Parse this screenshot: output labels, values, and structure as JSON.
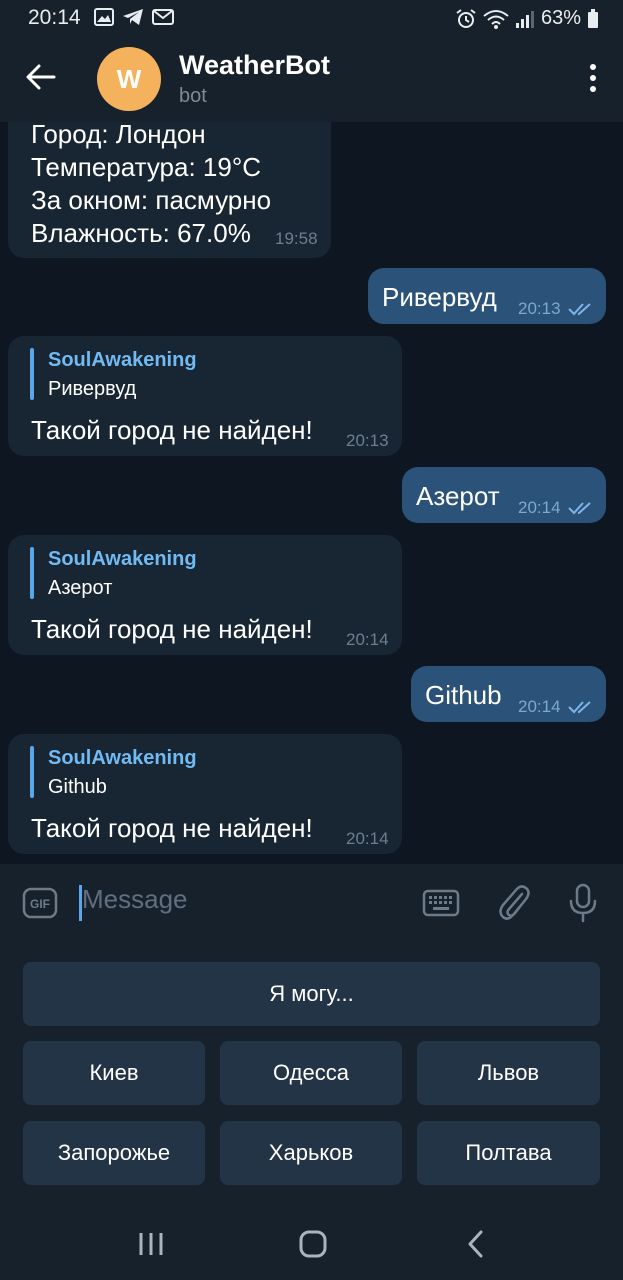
{
  "status_bar": {
    "time": "20:14",
    "battery": "63%",
    "left_icons": [
      "image-icon",
      "telegram-icon",
      "gmail-icon"
    ],
    "right_icons": [
      "alarm-icon",
      "wifi-icon",
      "signal-icon",
      "battery-icon"
    ]
  },
  "header": {
    "avatar_letter": "W",
    "avatar_color": "#f4b25c",
    "title": "WeatherBot",
    "subtitle": "bot"
  },
  "messages": [
    {
      "direction": "in",
      "lines": [
        "Город: Лондон",
        "Температура: 19°C",
        "За окном: пасмурно",
        "Влажность: 67.0%"
      ],
      "time": "19:58"
    },
    {
      "direction": "out",
      "text": "Ривервуд",
      "time": "20:13",
      "read": true
    },
    {
      "direction": "in",
      "reply_name": "SoulAwakening",
      "reply_text": "Ривервуд",
      "text": "Такой город не найден!",
      "time": "20:13"
    },
    {
      "direction": "out",
      "text": "Азерот",
      "time": "20:14",
      "read": true
    },
    {
      "direction": "in",
      "reply_name": "SoulAwakening",
      "reply_text": "Азерот",
      "text": "Такой город не найден!",
      "time": "20:14"
    },
    {
      "direction": "out",
      "text": "Github",
      "time": "20:14",
      "read": true
    },
    {
      "direction": "in",
      "reply_name": "SoulAwakening",
      "reply_text": "Github",
      "text": "Такой город не найден!",
      "time": "20:14"
    }
  ],
  "input": {
    "placeholder": "Message",
    "value": ""
  },
  "keyboard": {
    "rows": [
      [
        "Я могу..."
      ],
      [
        "Киев",
        "Одесса",
        "Львов"
      ],
      [
        "Запорожье",
        "Харьков",
        "Полтава"
      ]
    ]
  },
  "colors": {
    "chat_background": "#0e1621",
    "incoming_bubble": "#182533",
    "outgoing_bubble": "#2b5278",
    "accent": "#5aa6e8",
    "reply_name": "#71baf2"
  }
}
